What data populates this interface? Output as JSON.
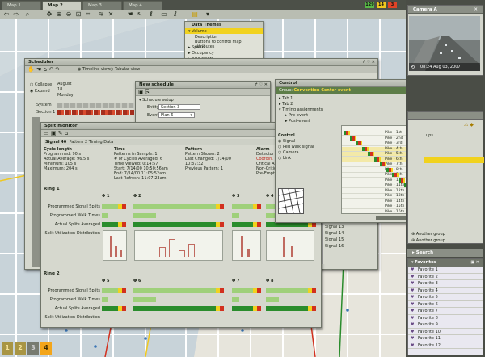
{
  "tabs": [
    "Map 1",
    "Map 2",
    "Map 3",
    "Map 4"
  ],
  "badges": [
    {
      "text": "129",
      "color": "#58b947"
    },
    {
      "text": "14",
      "color": "#f0c81e"
    },
    {
      "text": "3",
      "color": "#e04326"
    }
  ],
  "toolbar_icons": [
    "back-arrow-icon",
    "forward-arrow-icon",
    "zoom-icon",
    "pan-icon",
    "zoom-in-icon",
    "zoom-out-icon",
    "zoom-area-icon",
    "fit-icon",
    "layers-icon",
    "tools-icon",
    "select-hand-icon",
    "pointer-icon",
    "curve-tool-icon",
    "ruler-icon",
    "curve-alt-icon",
    "data-themes-icon"
  ],
  "data_themes": {
    "title": "Data Themes",
    "items": [
      "Volume",
      "Speed",
      "Occupancy",
      "ADA colors"
    ],
    "desc": "Description",
    "desc_text": "Buttons to control map attributes"
  },
  "scheduler": {
    "title": "Scheduler",
    "view1": "Timeline view",
    "view2": "Tabular view",
    "collapse": "Collapse",
    "expand": "Expand",
    "month": "August",
    "day": "18",
    "weekday": "Monday",
    "system": "System",
    "section": "Section 1"
  },
  "new_schedule": {
    "title": "New schedule",
    "setup": "Schedule setup",
    "entity_label": "Entity",
    "entity": "Section 3",
    "event_label": "Event",
    "event": "Plan 6"
  },
  "control": {
    "title": "Control",
    "group_prefix": "Group:",
    "group": "Convention Center event",
    "tree": [
      "Tab 1",
      "Tab 2",
      "Timing assignments",
      "Pre-event",
      "Post-event"
    ],
    "ctrl_title": "Control",
    "options": [
      "Signal",
      "Ped walk signal",
      "Camera",
      "Link"
    ],
    "pikes": [
      "Pike - 1st",
      "Pike - 2nd",
      "Pike - 3rd",
      "Pike - 4th",
      "Pike - 5th",
      "Pike - 6th",
      "Pike - 7th",
      "Pike - 8th",
      "Pike - 9th",
      "Pike - 10th",
      "Pike - 11th",
      "Pike - 12th",
      "Pike - 13th",
      "Pike - 14th",
      "Pike - 15th",
      "Pike - 16th"
    ]
  },
  "split": {
    "title": "Split monitor",
    "signal": "Signal 40",
    "pattern2": "Pattern 2 Timing Data",
    "cycle": {
      "h": "Cycle length",
      "lines": [
        "Programmed: 90 s",
        "Actual Average: 96.5 s",
        "Minimum: 105 s",
        "Maximum: 204 s"
      ]
    },
    "time": {
      "h": "Time",
      "lines": [
        "Patterns in Sample: 1",
        "# of Cycles Averaged: 6",
        "Time Viewed: 0:14:57",
        "Start: 7/14/00 10:50:56am",
        "End: 7/14/00 11:05:52am",
        "Last Refresh: 11:07:23am"
      ]
    },
    "pattern": {
      "h": "Pattern",
      "lines": [
        "Pattern Shown: 2",
        "Last Changed: 7/14/00 10:37:32",
        "Previous Pattern: 1"
      ]
    },
    "alarm": {
      "h": "Alarm",
      "lines": [
        "Detector",
        "Coordin.",
        "Critical Ala",
        "Non-Critic",
        "Pre-Empt"
      ]
    },
    "ring1": "Ring 1",
    "ring2": "Ring 2",
    "rows": [
      "Programmed Signal Splits",
      "Programmed Walk Times",
      "Actual Splits Averaged",
      "Split Utilization Distribution"
    ],
    "phases1": [
      "Φ 1",
      "Φ 2",
      "Φ 3",
      "Φ 4"
    ],
    "phases2": [
      "Φ 5",
      "Φ 6",
      "Φ 7",
      "Φ 8"
    ],
    "axis": "Time (Seconds)",
    "signals_left": [
      "Signal 13",
      "Signal 14",
      "Signal 15",
      "Signal 16"
    ]
  },
  "right": {
    "camera": "Camera A",
    "cam_time": "08:24  Aug 03, 2007",
    "groups": [
      "Another group",
      "Another group"
    ],
    "search": "Search",
    "favorites": "Favorites",
    "fav_items": [
      "Favorite 1",
      "Favorite 2",
      "Favorite 3",
      "Favorite 4",
      "Favorite 5",
      "Favorite 6",
      "Favorite 7",
      "Favorite 8",
      "Favorite 9",
      "Favorite 10",
      "Favorite 11",
      "Favorite 12"
    ],
    "ups": "ups"
  },
  "bottom_nav": [
    "1",
    "2",
    "3",
    "4"
  ]
}
